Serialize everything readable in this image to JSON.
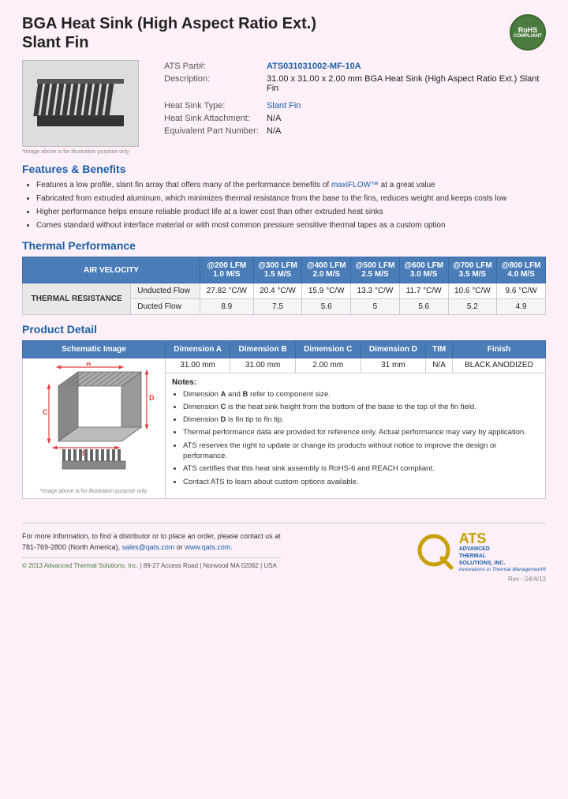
{
  "header": {
    "title_line1": "BGA Heat Sink (High Aspect Ratio Ext.)",
    "title_line2": "Slant Fin",
    "rohs": "RoHS",
    "compliant": "COMPLIANT"
  },
  "part_info": {
    "part_label": "ATS Part#:",
    "part_number": "ATS031031002-MF-10A",
    "description_label": "Description:",
    "description": "31.00 x 31.00 x 2.00 mm  BGA Heat Sink (High Aspect Ratio Ext.) Slant Fin",
    "heat_sink_type_label": "Heat Sink Type:",
    "heat_sink_type": "Slant Fin",
    "attachment_label": "Heat Sink Attachment:",
    "attachment": "N/A",
    "equiv_part_label": "Equivalent Part Number:",
    "equiv_part": "N/A"
  },
  "image_caption": "*Image above is for illustration purpose only",
  "features": {
    "title": "Features & Benefits",
    "items": [
      "Features a low profile, slant fin array that offers many of the performance benefits of maxiFLOW™ at a great value",
      "Fabricated from extruded aluminum, which minimizes thermal resistance from the base to the fins, reduces weight and keeps costs low",
      "Higher performance helps ensure reliable product life at a lower cost than other extruded heat sinks",
      "Comes standard without interface material or with most common pressure sensitive thermal tapes as a custom option"
    ],
    "maxiflow_link": "maxiFLOW™"
  },
  "thermal_performance": {
    "title": "Thermal Performance",
    "header_row": {
      "air_velocity": "AIR VELOCITY",
      "col1": "@200 LFM\n1.0 M/S",
      "col2": "@300 LFM\n1.5 M/S",
      "col3": "@400 LFM\n2.0 M/S",
      "col4": "@500 LFM\n2.5 M/S",
      "col5": "@600 LFM\n3.0 M/S",
      "col6": "@700 LFM\n3.5 M/S",
      "col7": "@800 LFM\n4.0 M/S"
    },
    "row_label": "THERMAL RESISTANCE",
    "rows": [
      {
        "type": "Unducted Flow",
        "values": [
          "27.82 °C/W",
          "20.4 °C/W",
          "15.9 °C/W",
          "13.3 °C/W",
          "11.7 °C/W",
          "10.6 °C/W",
          "9.6 °C/W"
        ]
      },
      {
        "type": "Ducted Flow",
        "values": [
          "8.9",
          "7.5",
          "5.6",
          "5",
          "5.6",
          "5.2",
          "4.9"
        ]
      }
    ]
  },
  "product_detail": {
    "title": "Product Detail",
    "headers": [
      "Schematic Image",
      "Dimension A",
      "Dimension B",
      "Dimension C",
      "Dimension D",
      "TIM",
      "Finish"
    ],
    "values": {
      "dim_a": "31.00 mm",
      "dim_b": "31.00 mm",
      "dim_c": "2.00 mm",
      "dim_d": "31 mm",
      "tim": "N/A",
      "finish": "BLACK ANODIZED"
    },
    "notes_title": "Notes:",
    "notes": [
      "Dimension A and B refer to component size.",
      "Dimension C is the heat sink height from the bottom of the base to the top of the fin field.",
      "Dimension D is fin tip to fin tip.",
      "Thermal performance data are provided for reference only. Actual performance may vary by application.",
      "ATS reserves the right to update or change its products without notice to improve the design or performance.",
      "ATS certifies that this heat sink assembly is RoHS-6 and REACH compliant.",
      "Contact ATS to learn about custom options available."
    ],
    "schematic_caption": "*Image above is for illustration purpose only."
  },
  "footer": {
    "contact_text": "For more information, to find a distributor or to place an order, please contact us at",
    "phone": "781-769-2800 (North America),",
    "email": "sales@qats.com",
    "or": "or",
    "website": "www.qats.com.",
    "copyright": "© 2013 Advanced Thermal Solutions, Inc.",
    "address": "| 89-27 Access Road  |  Norwood MA  02062  | USA",
    "ats_big": "ATS",
    "ats_full_line1": "ADVANCED",
    "ats_full_line2": "THERMAL",
    "ats_full_line3": "SOLUTIONS, INC.",
    "ats_tagline": "Innovations in Thermal Management®",
    "rev": "Rev - 04/4/13"
  }
}
